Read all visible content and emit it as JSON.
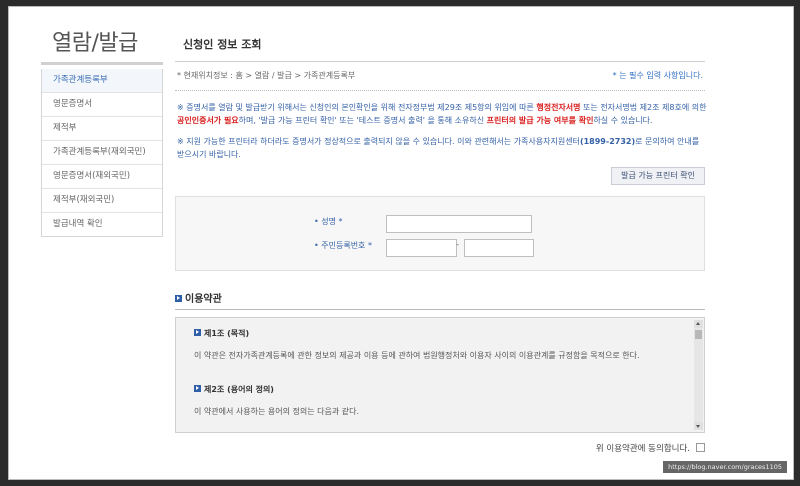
{
  "sidebar": {
    "title": "열람/발급",
    "items": [
      {
        "label": "가족관계등록부"
      },
      {
        "label": "영문증명서"
      },
      {
        "label": "제적부"
      },
      {
        "label": "가족관계등록부(재외국민)"
      },
      {
        "label": "영문증명서(재외국민)"
      },
      {
        "label": "제적부(재외국민)"
      },
      {
        "label": "발급내역 확인"
      }
    ],
    "active_index": 0
  },
  "main": {
    "title": "신청인 정보 조회",
    "breadcrumb": "* 현재위치정보 : 홈 > 열람 / 발급 > 가족관계등록부",
    "required_note": "* 는 필수 입력 사항입니다.",
    "notice1": {
      "p1": "※ 증명서를 열람 및 발급받기 위해서는 신청인의 본인확인을 위해 전자정부법 제29조 제5항의 위임에 따른 ",
      "r1": "행정전자서명",
      "p2": " 또는 전자서명법 제2조 제8호에 의한 ",
      "r2": "공인인증서가 필요",
      "p3": "하며, '발급 가능 프린터 확인' 또는 '테스트 증명서 출력' 을 통해 소유하신 ",
      "r3": "프린터의 발급 가능 여부를 확인",
      "p4": "하실 수 있습니다."
    },
    "notice2": {
      "p1": "※ 지원 가능한 프린터라 하더라도 증명서가 정상적으로 출력되지 않을 수 있습니다. 이와 관련해서는 가족사용자지원센터",
      "phone": "(1899-2732)",
      "p2": "로 문의하여 안내를 받으시기 바랍니다."
    },
    "printer_button": "발급 가능 프린터 확인",
    "form": {
      "name_label": "• 성명 *",
      "name_value": "",
      "rrn_label": "• 주민등록번호 *",
      "rrn_front": "",
      "rrn_sep": "-",
      "rrn_back": ""
    },
    "terms": {
      "heading": "이용약관",
      "articles": [
        {
          "title": "제1조 (목적)",
          "body": "이 약관은 전자가족관계등록에 관한 정보의 제공과 이용 등에 관하여 법원행정처와 이용자 사이의 이용관계를 규정함을 목적으로 한다."
        },
        {
          "title": "제2조 (용어의 정의)",
          "body": "이 약관에서 사용하는 용어의 정의는 다음과 같다."
        }
      ]
    },
    "agree_label": "위 이용약관에 동의합니다."
  },
  "watermark": "https://blog.naver.com/graces1105",
  "colors": {
    "accent": "#3561a6",
    "highlight_red": "#d81e1e",
    "square_icon": "#2f5fa8"
  }
}
